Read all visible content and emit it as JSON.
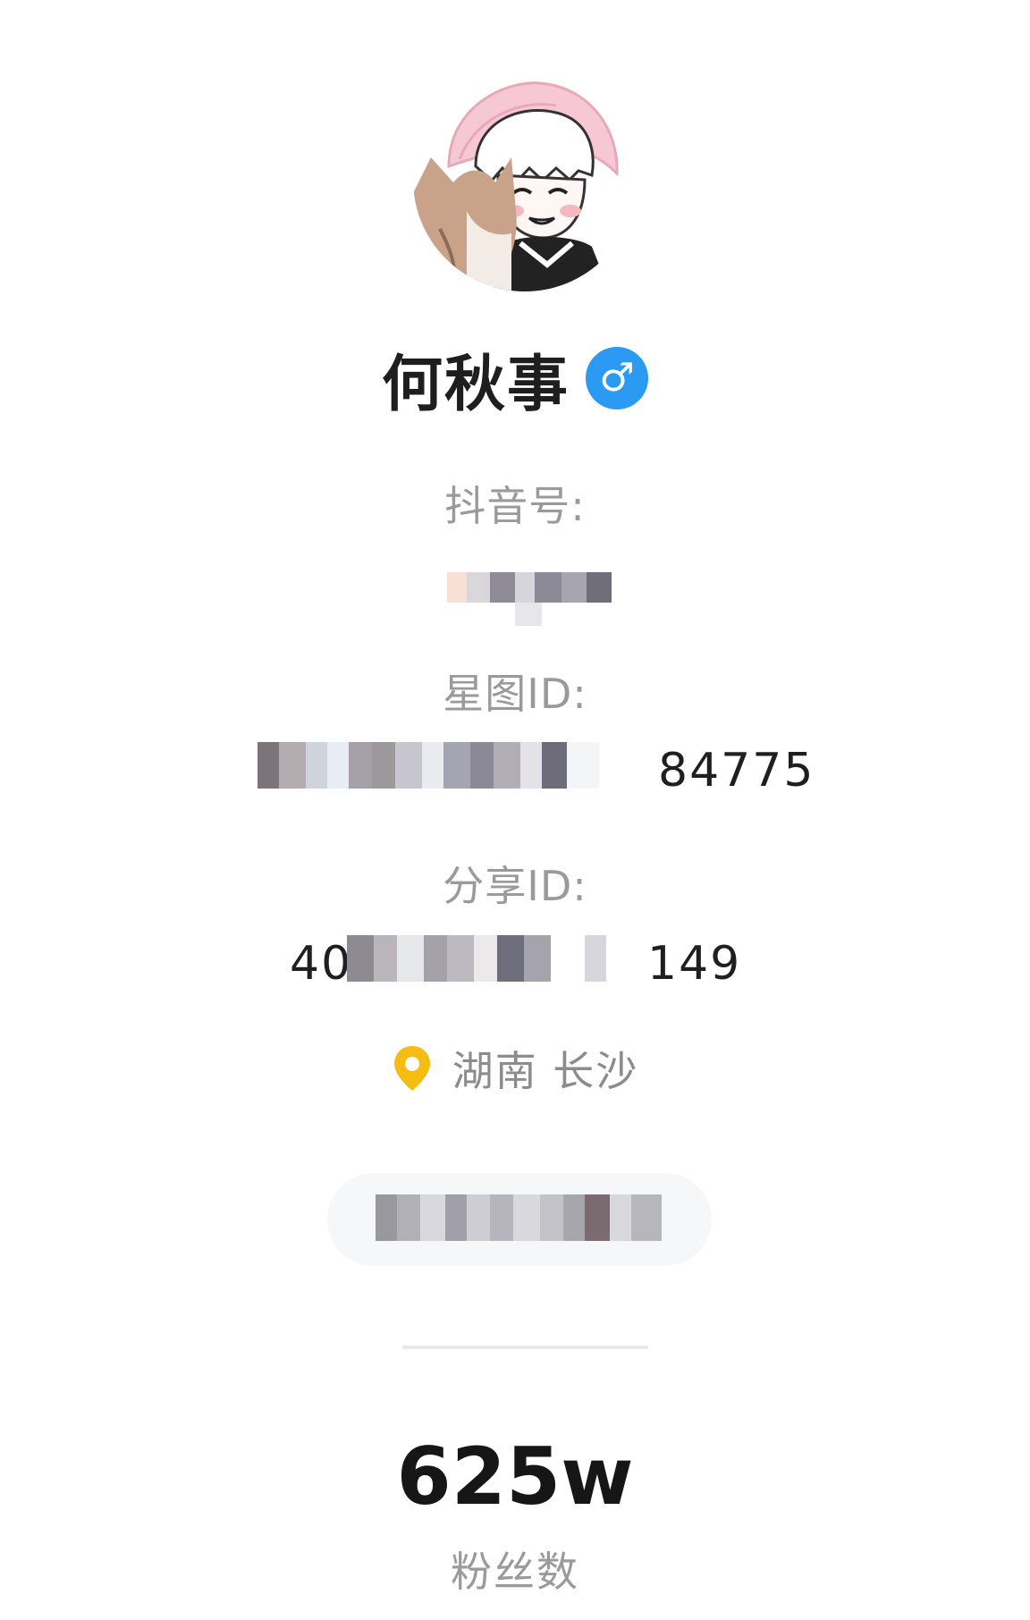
{
  "profile": {
    "name": "何秋事",
    "gender_symbol": "♂",
    "gender_icon": "male-icon",
    "gender_color": "#2b9af3",
    "avatar_icon": "anime-avatar-with-cat"
  },
  "ids": {
    "douyin_label": "抖音号:",
    "xingtu_label": "星图ID:",
    "xingtu_visible_suffix": "84775",
    "share_label": "分享ID:",
    "share_visible_prefix": "40",
    "share_visible_suffix": "149"
  },
  "location": {
    "icon": "location-pin-icon",
    "icon_color": "#f5bd12",
    "text": "湖南 长沙"
  },
  "stats": {
    "followers_value": "625w",
    "followers_label": "粉丝数"
  }
}
